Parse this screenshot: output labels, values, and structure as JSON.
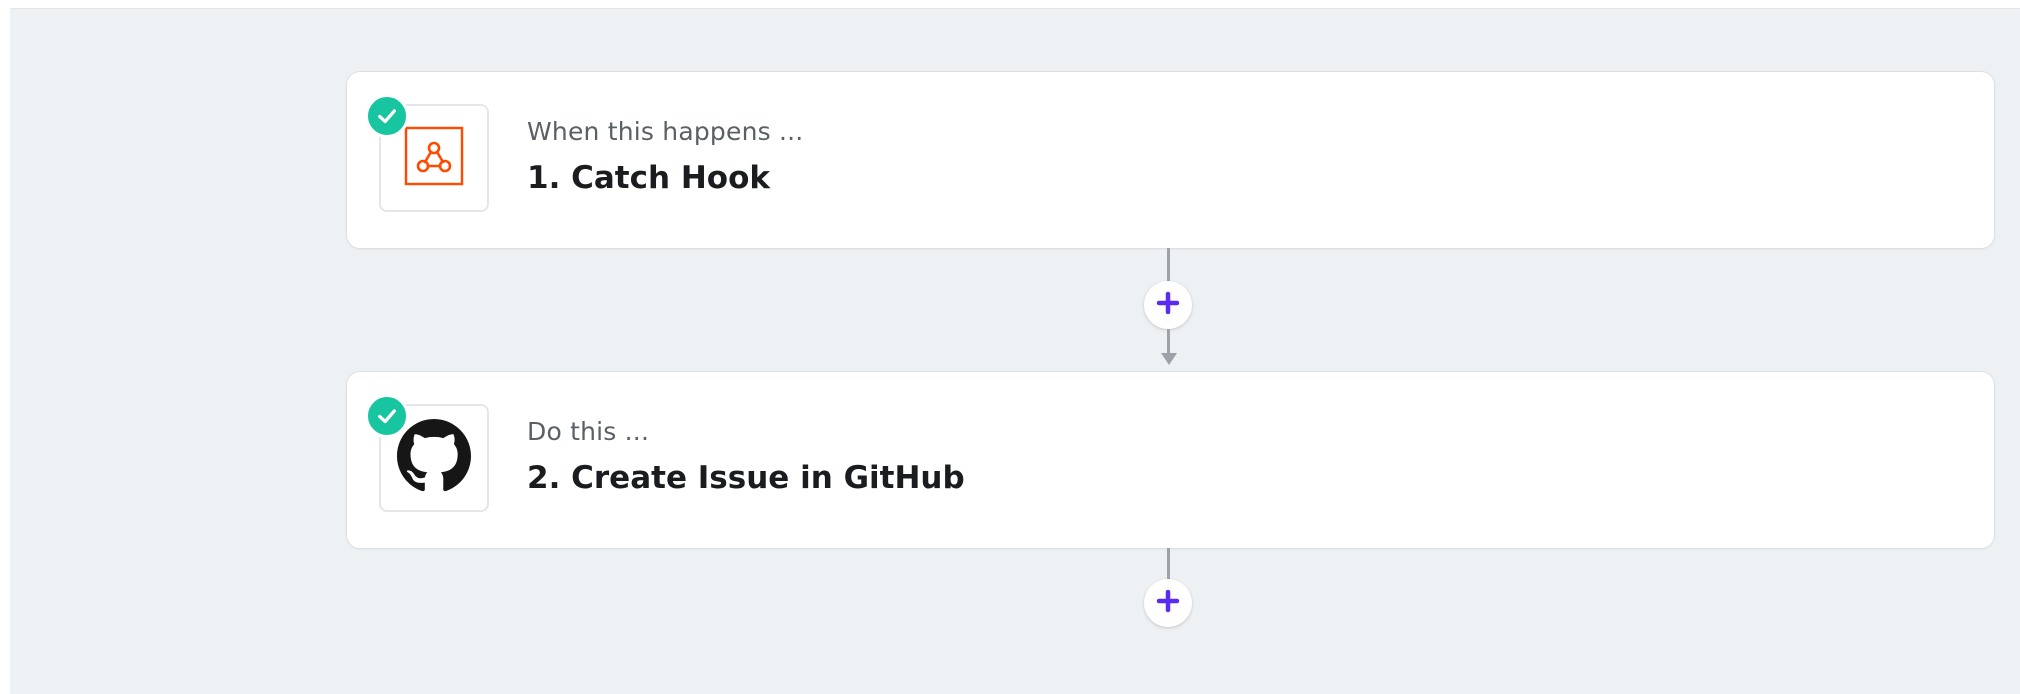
{
  "steps": [
    {
      "subtitle": "When this happens ...",
      "title": "1. Catch Hook",
      "app_icon": "webhook-icon",
      "status_icon": "check-icon"
    },
    {
      "subtitle": "Do this ...",
      "title": "2. Create Issue in GitHub",
      "app_icon": "github-icon",
      "status_icon": "check-icon"
    }
  ],
  "add_step_icon": "plus-icon",
  "colors": {
    "canvas_background": "#eef1f4",
    "check_badge": "#17c6a0",
    "webhook_accent": "#ff4a00",
    "plus_accent": "#5a2bf2",
    "connector": "#9da2a8"
  }
}
